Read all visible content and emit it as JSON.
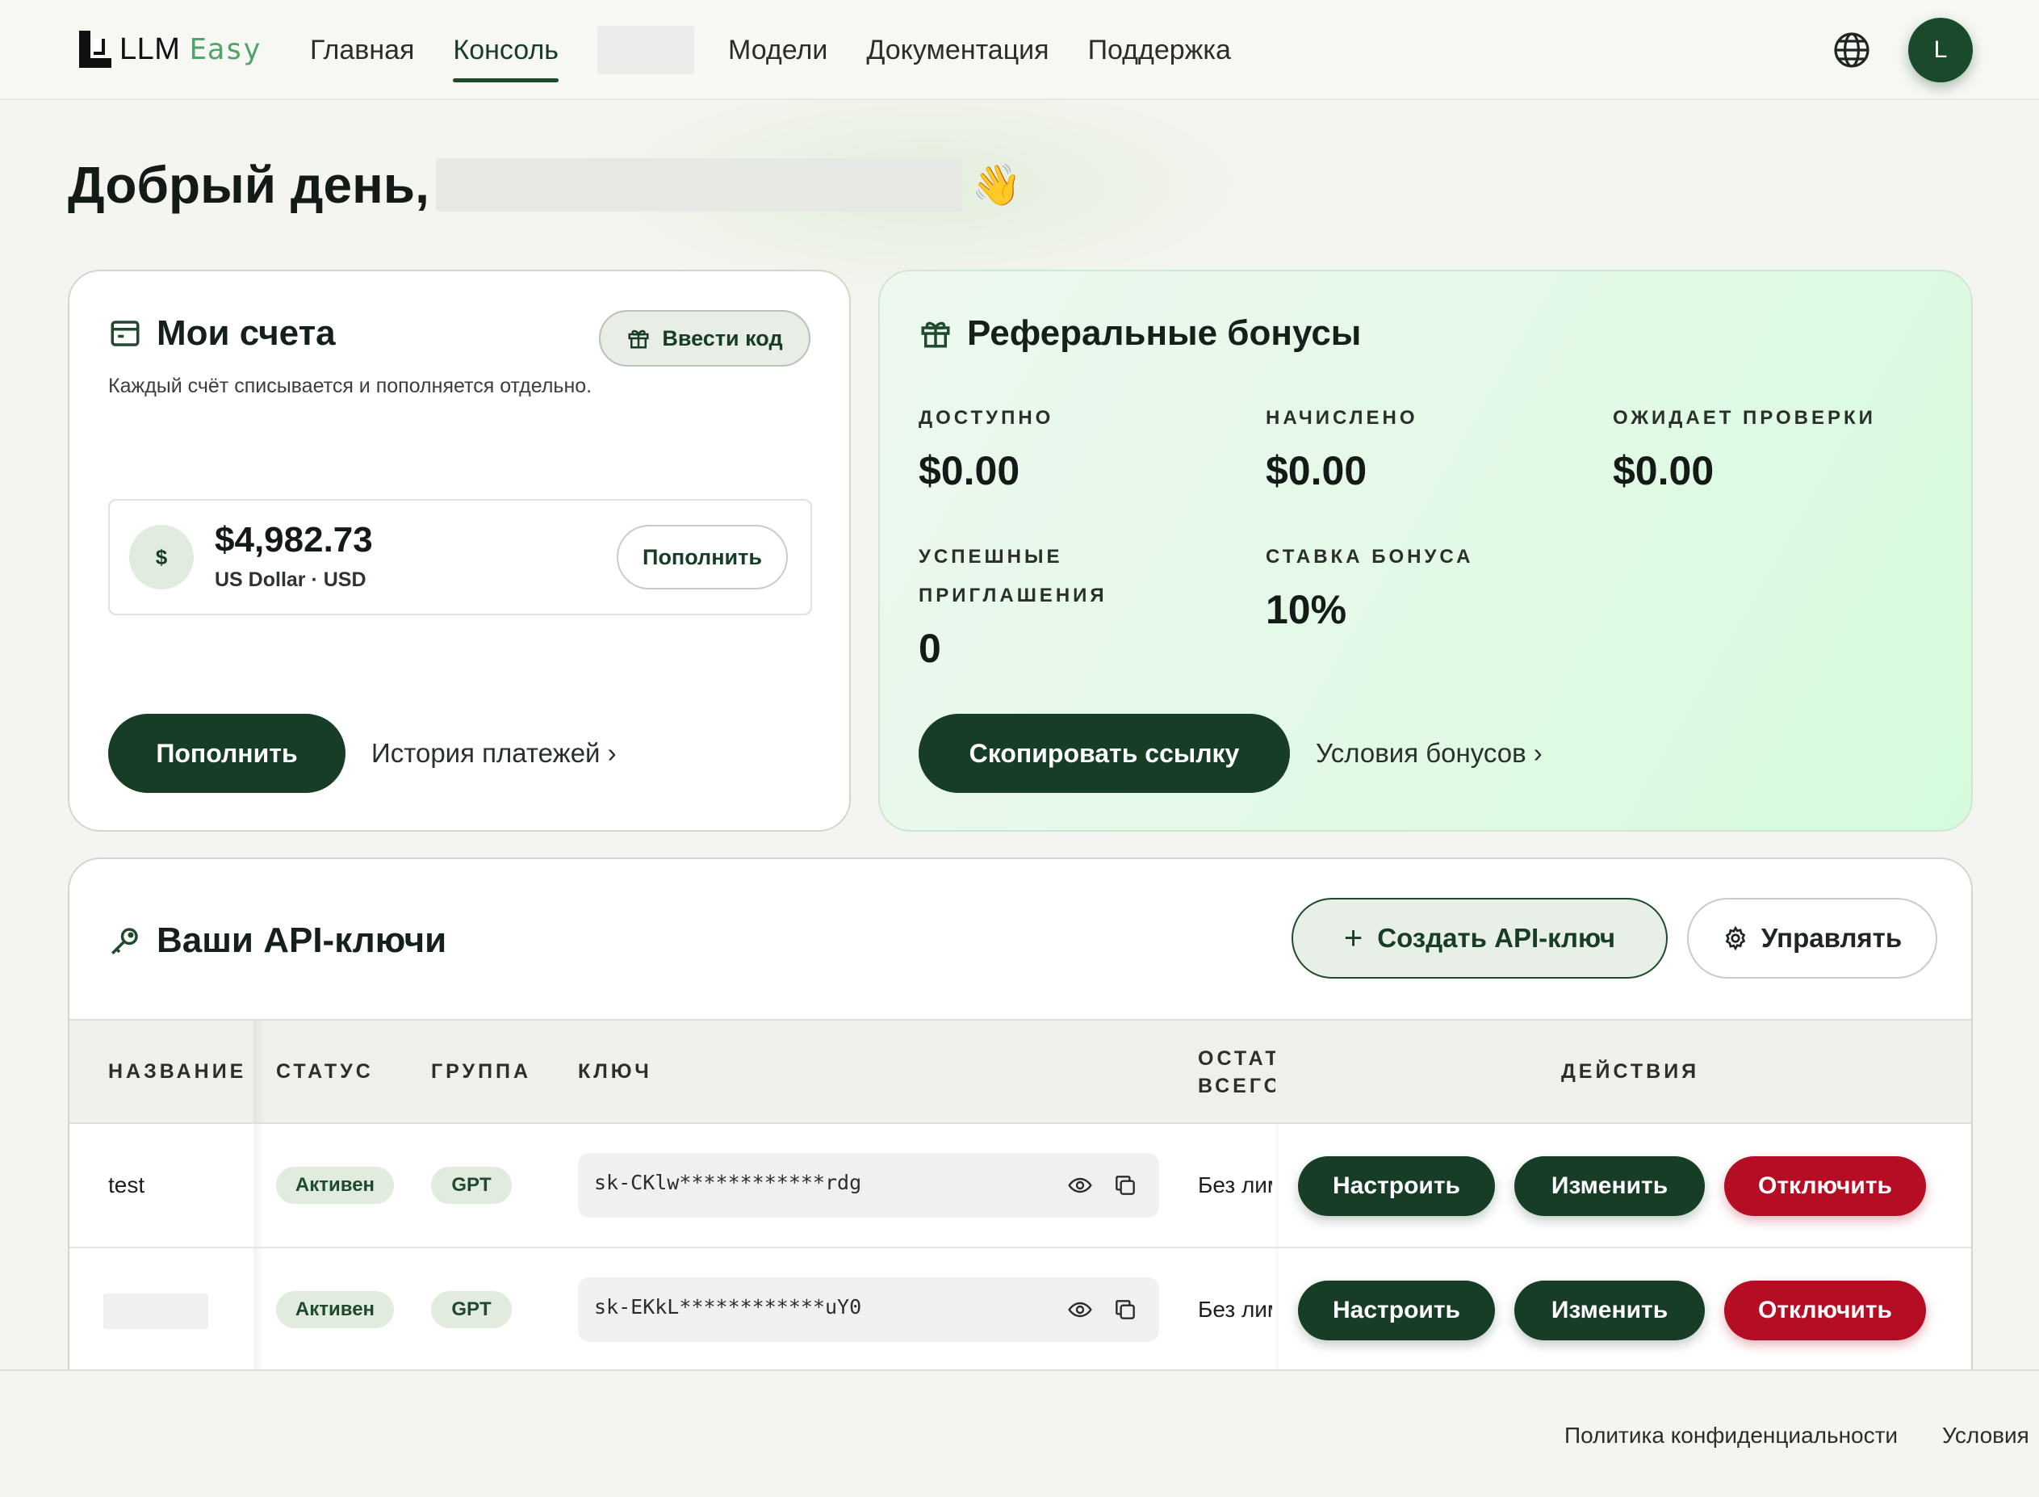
{
  "brand": {
    "logo_text_main": "LLM ",
    "logo_text_accent": "Easy"
  },
  "nav": {
    "items": [
      {
        "label": "Главная"
      },
      {
        "label": "Консоль",
        "active": true
      },
      {
        "label": "Модели"
      },
      {
        "label": "Документация"
      },
      {
        "label": "Поддержка"
      }
    ]
  },
  "user": {
    "avatar_initial": "L"
  },
  "greeting": {
    "text": "Добрый день,",
    "emoji": "👋"
  },
  "accounts": {
    "title": "Мои счета",
    "subtitle": "Каждый счёт списывается и пополняется отдельно.",
    "enter_code_label": "Ввести код",
    "currency_symbol": "$",
    "balance": "$4,982.73",
    "currency_name": "US Dollar · USD",
    "topup_small_label": "Пополнить",
    "topup_label": "Пополнить",
    "history_link": "История платежей ›"
  },
  "referral": {
    "title": "Реферальные бонусы",
    "stats": {
      "available": {
        "label": "ДОСТУПНО",
        "value": "$0.00"
      },
      "accrued": {
        "label": "НАЧИСЛЕНО",
        "value": "$0.00"
      },
      "pending": {
        "label": "ОЖИДАЕТ ПРОВЕРКИ",
        "value": "$0.00"
      },
      "invites": {
        "label_line1": "УСПЕШНЫЕ",
        "label_line2": "ПРИГЛАШЕНИЯ",
        "value": "0"
      },
      "rate": {
        "label": "СТАВКА БОНУСА",
        "value": "10%"
      }
    },
    "copy_link_label": "Скопировать ссылку",
    "terms_link": "Условия бонусов ›"
  },
  "api_keys": {
    "title": "Ваши API-ключи",
    "create_label": "Создать API-ключ",
    "manage_label": "Управлять",
    "columns": {
      "name": "НАЗВАНИЕ",
      "status": "СТАТУС",
      "group": "ГРУППА",
      "key": "КЛЮЧ",
      "remain_line1": "ОСТАТОК",
      "remain_line2": "ВСЕГО",
      "actions": "ДЕЙСТВИЯ"
    },
    "rows": [
      {
        "name": "test",
        "status": "Активен",
        "group": "GPT",
        "key": "sk-CKlw************rdg",
        "remain": "Без лимита",
        "configure": "Настроить",
        "edit": "Изменить",
        "disable": "Отключить"
      },
      {
        "name": "",
        "status": "Активен",
        "group": "GPT",
        "key": "sk-EKkL************uY0",
        "remain": "Без лимита",
        "configure": "Настроить",
        "edit": "Изменить",
        "disable": "Отключить"
      }
    ]
  },
  "footer": {
    "privacy": "Политика конфиденциальности",
    "terms": "Условия"
  },
  "colors": {
    "brand_green": "#173d26",
    "danger_red": "#b40d24",
    "accent_light_green": "#4fa36b"
  }
}
